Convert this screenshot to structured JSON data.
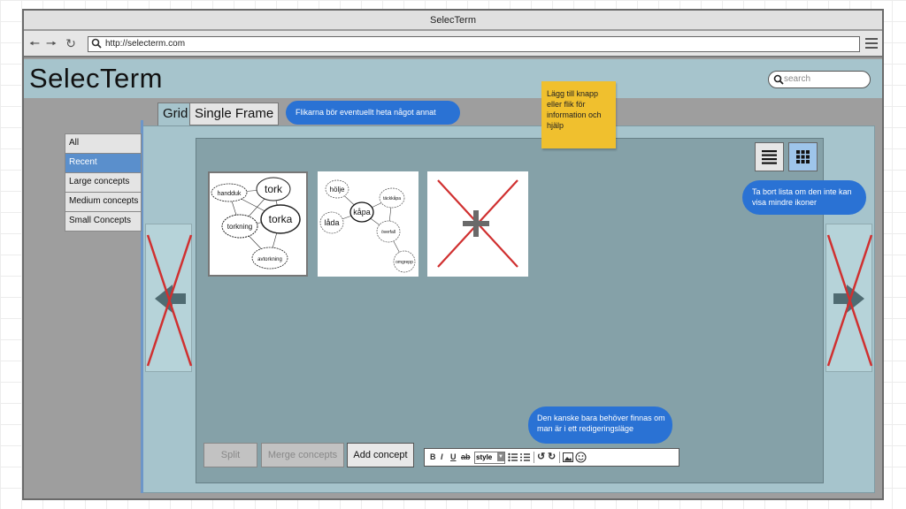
{
  "window": {
    "title": "SelecTerm"
  },
  "browser": {
    "url": "http://selecterm.com"
  },
  "header": {
    "logo": "SelecTerm",
    "search_placeholder": "search"
  },
  "tabs": [
    {
      "label": "Grid",
      "active": true
    },
    {
      "label": "Single Frame",
      "active": false
    }
  ],
  "sidebar": {
    "items": [
      {
        "label": "All",
        "selected": false
      },
      {
        "label": "Recent",
        "selected": true
      },
      {
        "label": "Large concepts",
        "selected": false
      },
      {
        "label": "Medium concepts",
        "selected": false
      },
      {
        "label": "Small Concepts",
        "selected": false
      }
    ]
  },
  "view_buttons": [
    {
      "icon": "list-view-icon",
      "active": false
    },
    {
      "icon": "grid-view-icon",
      "active": true
    }
  ],
  "thumbnails": [
    {
      "words": [
        "tork",
        "torka",
        "torkning",
        "handduk",
        "avtorkning"
      ]
    },
    {
      "words": [
        "hölje",
        "kåpa",
        "låda",
        "överfall",
        "täckkåpa",
        "omgrepp"
      ]
    },
    {
      "placeholder": true
    }
  ],
  "actions": {
    "split": "Split",
    "merge": "Merge concepts",
    "add": "Add concept"
  },
  "editor_toolbar": {
    "bold": "B",
    "italic": "I",
    "underline": "U",
    "strike": "ab",
    "style": "style"
  },
  "annotations": {
    "tabs_note": "Flikarna bör eventuellt heta något annat",
    "help_note": "Lägg till knapp eller flik för information och hjälp",
    "list_note": "Ta bort lista om den inte kan visa mindre ikoner",
    "edit_note": "Den kanske bara behöver finnas om man är i ett redigeringsläge"
  },
  "colors": {
    "header": "#a6c4cc",
    "selected": "#5a8fcc",
    "bubble": "#2a72d4",
    "sticky": "#f0c02e",
    "cross": "#d03030"
  }
}
